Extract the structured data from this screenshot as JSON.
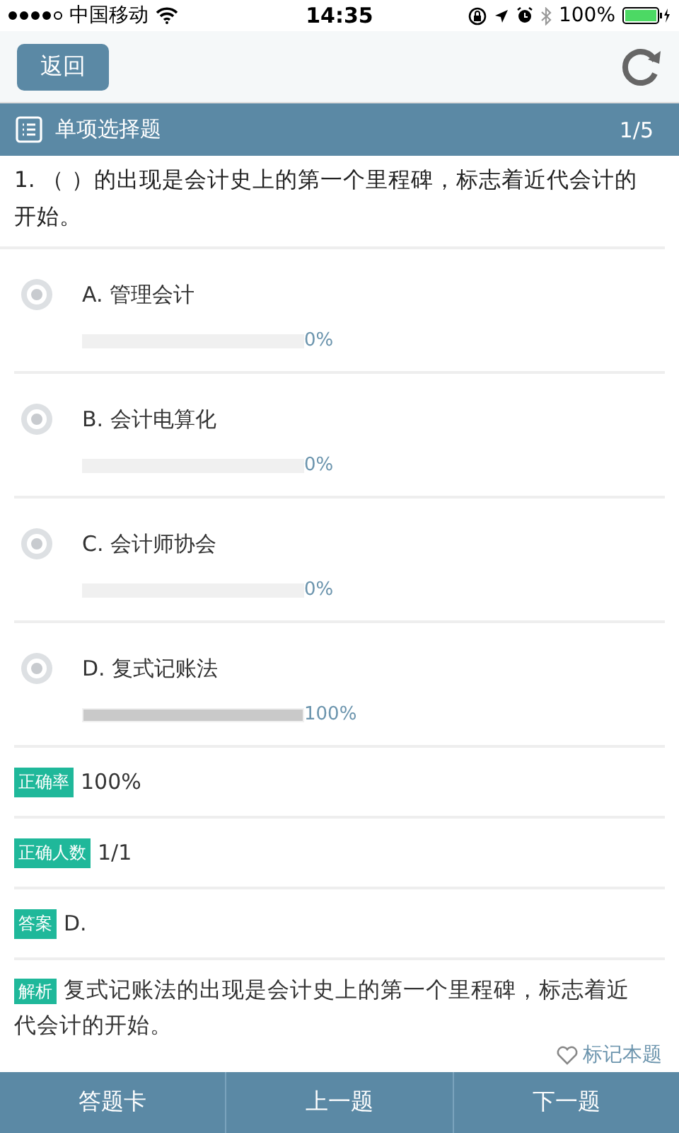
{
  "status_bar": {
    "carrier": "中国移动",
    "time": "14:35",
    "battery": "100%"
  },
  "nav": {
    "back": "返回"
  },
  "section": {
    "title": "单项选择题",
    "progress": "1/5"
  },
  "question": "1. （ ）的出现是会计史上的第一个里程碑，标志着近代会计的开始。",
  "options": [
    {
      "label": "A. 管理会计",
      "selected": false,
      "level": 0,
      "reading": "0%"
    },
    {
      "label": "B. 会计电算化",
      "selected": false,
      "level": 0,
      "reading": "0%"
    },
    {
      "label": "C. 会计师协会",
      "selected": false,
      "level": 0,
      "reading": "0%"
    },
    {
      "label": "D. 复式记账法",
      "selected": false,
      "level": 1,
      "reading": "100%"
    }
  ],
  "stats": [
    {
      "tag": "正确率",
      "value": "100%"
    },
    {
      "tag": "正确人数",
      "value": "1/1"
    },
    {
      "tag": "答案",
      "value": "D."
    }
  ],
  "analysis": {
    "tag": "解析",
    "text": "复式记账法的出现是会计史上的第一个里程碑，标志着近代会计的开始。"
  },
  "bookmark": "标记本题",
  "bottom_tabs": [
    "答题卡",
    "上一题",
    "下一题"
  ]
}
